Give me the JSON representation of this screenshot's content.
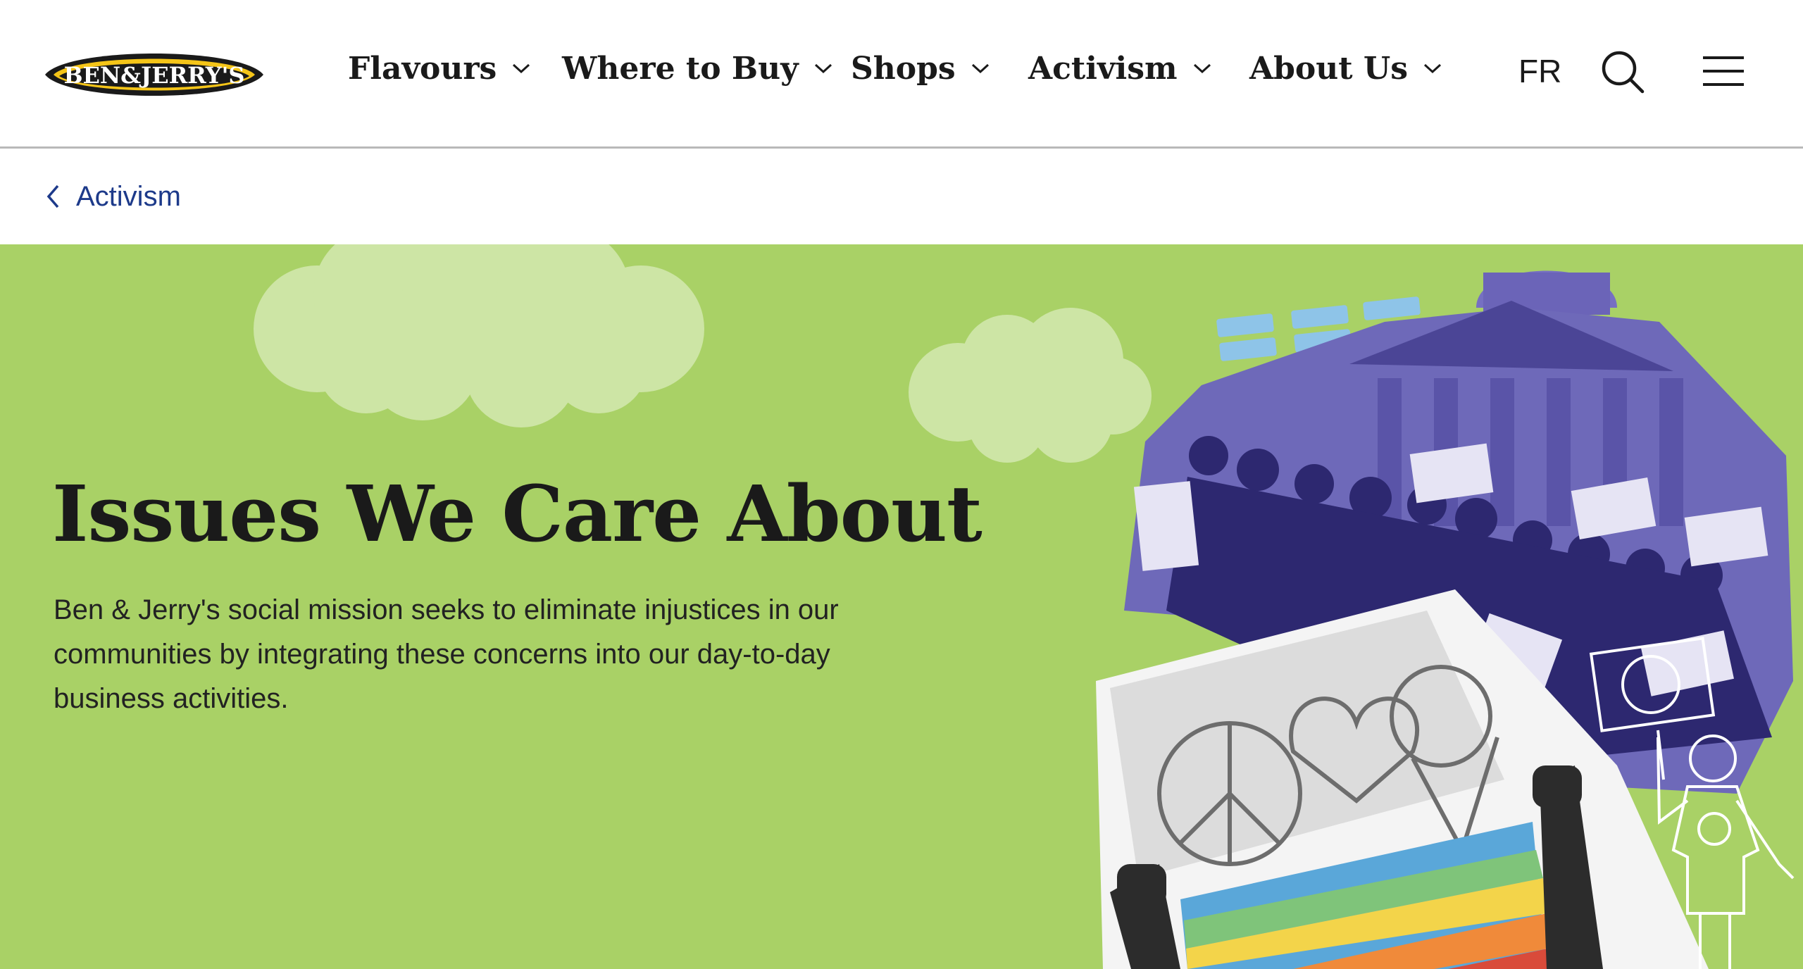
{
  "brand": {
    "logo_text": "BEN&JERRY'S",
    "colors": {
      "logo_bg": "#1a1a1a",
      "logo_fill": "#f5c518",
      "hero_green": "#a9d166",
      "link_blue": "#1d3a8a"
    }
  },
  "nav": {
    "items": [
      {
        "label": "Flavours",
        "icon": "chevron-down-icon"
      },
      {
        "label": "Where to Buy",
        "icon": "chevron-down-icon"
      },
      {
        "label": "Shops",
        "icon": "chevron-down-icon"
      },
      {
        "label": "Activism",
        "icon": "chevron-down-icon"
      },
      {
        "label": "About Us",
        "icon": "chevron-down-icon"
      }
    ],
    "language": "FR",
    "search_icon": "search-icon",
    "menu_icon": "hamburger-menu-icon"
  },
  "breadcrumb": {
    "label": "Activism",
    "icon": "chevron-left-icon"
  },
  "hero": {
    "title": "Issues We Care About",
    "description": "Ben & Jerry's social mission seeks to eliminate injustices in our communities by integrating these concerns into our day-to-day business activities."
  }
}
